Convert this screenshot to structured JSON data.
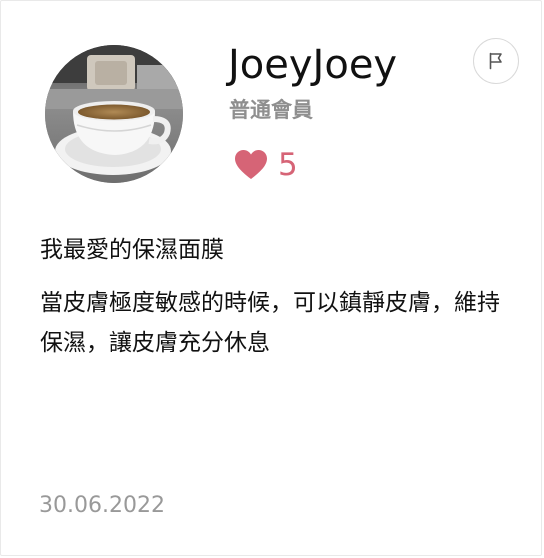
{
  "review": {
    "username": "JoeyJoey",
    "member_level": "普通會員",
    "like_count": "5",
    "title": "我最愛的保濕面膜",
    "body": "當皮膚極度敏感的時候，可以鎮靜皮膚，維持保濕，讓皮膚充分休息",
    "date": "30.06.2022"
  },
  "icons": {
    "like": "heart-icon",
    "report": "flag-icon"
  },
  "colors": {
    "heart": "#d66476",
    "like_count": "#d66476",
    "member_level": "#8f8f8f",
    "date": "#999999",
    "text": "#111111"
  }
}
